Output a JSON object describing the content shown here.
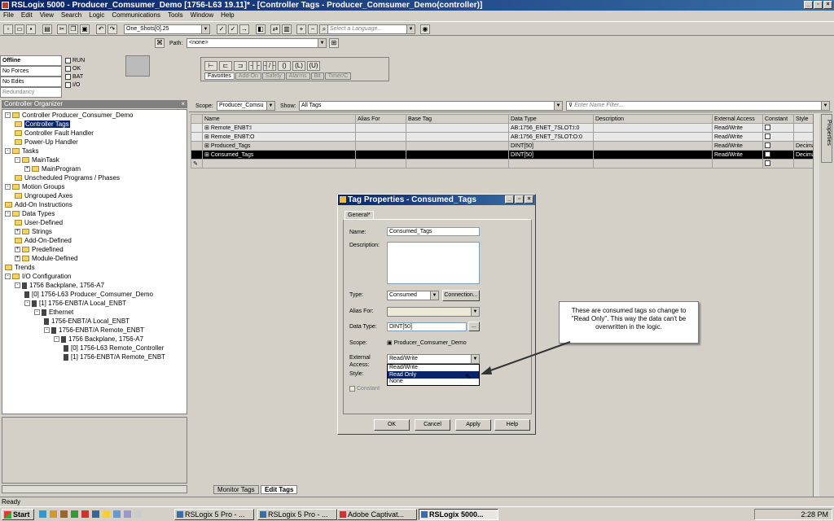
{
  "window": {
    "title": "RSLogix 5000 - Producer_Comsumer_Demo [1756-L63 19.11]* - [Controller Tags - Producer_Comsumer_Demo(controller)]"
  },
  "menu": [
    "File",
    "Edit",
    "View",
    "Search",
    "Logic",
    "Communications",
    "Tools",
    "Window",
    "Help"
  ],
  "toolbar": {
    "tag_combo": "One_Shots[0].25",
    "language_placeholder": "Select a Language...",
    "path_label": "Path:",
    "path_value": "<none>"
  },
  "status": {
    "mode": "Offline",
    "forces": "No Forces",
    "edits": "No Edits",
    "redundancy": "Redundancy",
    "indicators": [
      "RUN",
      "OK",
      "BAT",
      "I/O"
    ]
  },
  "instr_tabs": [
    "Favorites",
    "Add-On",
    "Safety",
    "Alarms",
    "Bit",
    "Timer/C"
  ],
  "organizer": {
    "title": "Controller Organizer",
    "items": [
      {
        "label": "Controller Producer_Consumer_Demo",
        "level": 0,
        "kind": "folder",
        "exp": "-"
      },
      {
        "label": "Controller Tags",
        "level": 1,
        "kind": "folder",
        "sel": true
      },
      {
        "label": "Controller Fault Handler",
        "level": 1,
        "kind": "folder"
      },
      {
        "label": "Power-Up Handler",
        "level": 1,
        "kind": "folder"
      },
      {
        "label": "Tasks",
        "level": 0,
        "kind": "folder",
        "exp": "-"
      },
      {
        "label": "MainTask",
        "level": 1,
        "kind": "folder",
        "exp": "-"
      },
      {
        "label": "MainProgram",
        "level": 2,
        "kind": "folder",
        "exp": "+"
      },
      {
        "label": "Unscheduled Programs / Phases",
        "level": 1,
        "kind": "folder"
      },
      {
        "label": "Motion Groups",
        "level": 0,
        "kind": "folder",
        "exp": "-"
      },
      {
        "label": "Ungrouped Axes",
        "level": 1,
        "kind": "folder"
      },
      {
        "label": "Add-On Instructions",
        "level": 0,
        "kind": "folder"
      },
      {
        "label": "Data Types",
        "level": 0,
        "kind": "folder",
        "exp": "-"
      },
      {
        "label": "User-Defined",
        "level": 1,
        "kind": "folder"
      },
      {
        "label": "Strings",
        "level": 1,
        "kind": "folder",
        "exp": "+"
      },
      {
        "label": "Add-On-Defined",
        "level": 1,
        "kind": "folder"
      },
      {
        "label": "Predefined",
        "level": 1,
        "kind": "folder",
        "exp": "+"
      },
      {
        "label": "Module-Defined",
        "level": 1,
        "kind": "folder",
        "exp": "+"
      },
      {
        "label": "Trends",
        "level": 0,
        "kind": "folder"
      },
      {
        "label": "I/O Configuration",
        "level": 0,
        "kind": "folder",
        "exp": "-"
      },
      {
        "label": "1756 Backplane, 1756-A7",
        "level": 1,
        "kind": "dev",
        "exp": "-"
      },
      {
        "label": "[0] 1756-L63 Producer_Comsumer_Demo",
        "level": 2,
        "kind": "dev"
      },
      {
        "label": "[1] 1756-ENBT/A Local_ENBT",
        "level": 2,
        "kind": "dev",
        "exp": "-"
      },
      {
        "label": "Ethernet",
        "level": 3,
        "kind": "dev",
        "exp": "-"
      },
      {
        "label": "1756-ENBT/A Local_ENBT",
        "level": 4,
        "kind": "dev"
      },
      {
        "label": "1756-ENBT/A Remote_ENBT",
        "level": 4,
        "kind": "dev",
        "exp": "-"
      },
      {
        "label": "1756 Backplane, 1756-A7",
        "level": 5,
        "kind": "dev",
        "exp": "-"
      },
      {
        "label": "[0] 1756-L63 Remote_Controller",
        "level": 6,
        "kind": "dev"
      },
      {
        "label": "[1] 1756-ENBT/A Remote_ENBT",
        "level": 6,
        "kind": "dev"
      }
    ]
  },
  "tags_view": {
    "scope_label": "Scope:",
    "scope_value": "Producer_Comsu",
    "show_label": "Show:",
    "show_value": "All Tags",
    "filter_placeholder": "Enter Name Filter...",
    "columns": [
      "Name",
      "Alias For",
      "Base Tag",
      "Data Type",
      "Description",
      "External Access",
      "Constant",
      "Style"
    ],
    "rows": [
      {
        "name": "Remote_ENBT:I",
        "alias": "",
        "base": "",
        "type": "AB:1756_ENET_7SLOT:I:0",
        "desc": "",
        "access": "Read/Write",
        "style": "",
        "gray": true
      },
      {
        "name": "Remote_ENBT:O",
        "alias": "",
        "base": "",
        "type": "AB:1756_ENET_7SLOT:O:0",
        "desc": "",
        "access": "Read/Write",
        "style": "",
        "gray": true
      },
      {
        "name": "Produced_Tags",
        "alias": "",
        "base": "",
        "type": "DINT[50]",
        "desc": "",
        "access": "Read/Write",
        "style": "Decima"
      },
      {
        "name": "Consumed_Tags",
        "alias": "",
        "base": "",
        "type": "DINT[50]",
        "desc": "",
        "access": "Read/Write",
        "style": "Decima",
        "sel": true
      }
    ],
    "bottom_tabs": [
      "Monitor Tags",
      "Edit Tags"
    ]
  },
  "dialog": {
    "title": "Tag Properties - Consumed_Tags",
    "tab": "General*",
    "name_label": "Name:",
    "name_value": "Consumed_Tags",
    "desc_label": "Description:",
    "type_label": "Type:",
    "type_value": "Consumed",
    "connection_btn": "Connection...",
    "alias_label": "Alias For:",
    "datatype_label": "Data Type:",
    "datatype_value": "DINT[50]",
    "scope_label": "Scope:",
    "scope_value": "Producer_Comsumer_Demo",
    "ext_label": "External Access:",
    "ext_value": "Read/Write",
    "ext_options": [
      "Read/Write",
      "Read Only",
      "None"
    ],
    "style_label": "Style:",
    "constant_label": "Constant",
    "buttons": [
      "OK",
      "Cancel",
      "Apply",
      "Help"
    ]
  },
  "callout": "These are consumed tags so change to \"Read Only\". This way the data can't be overwritten in the logic.",
  "side_tab": "Properties",
  "statusbar": "Ready",
  "taskbar": {
    "start": "Start",
    "tasks": [
      "RSLogix 5 Pro - ...",
      "RSLogix 5 Pro - ...",
      "Adobe Captivat...",
      "RSLogix 5000..."
    ],
    "clock": "2:28 PM"
  }
}
